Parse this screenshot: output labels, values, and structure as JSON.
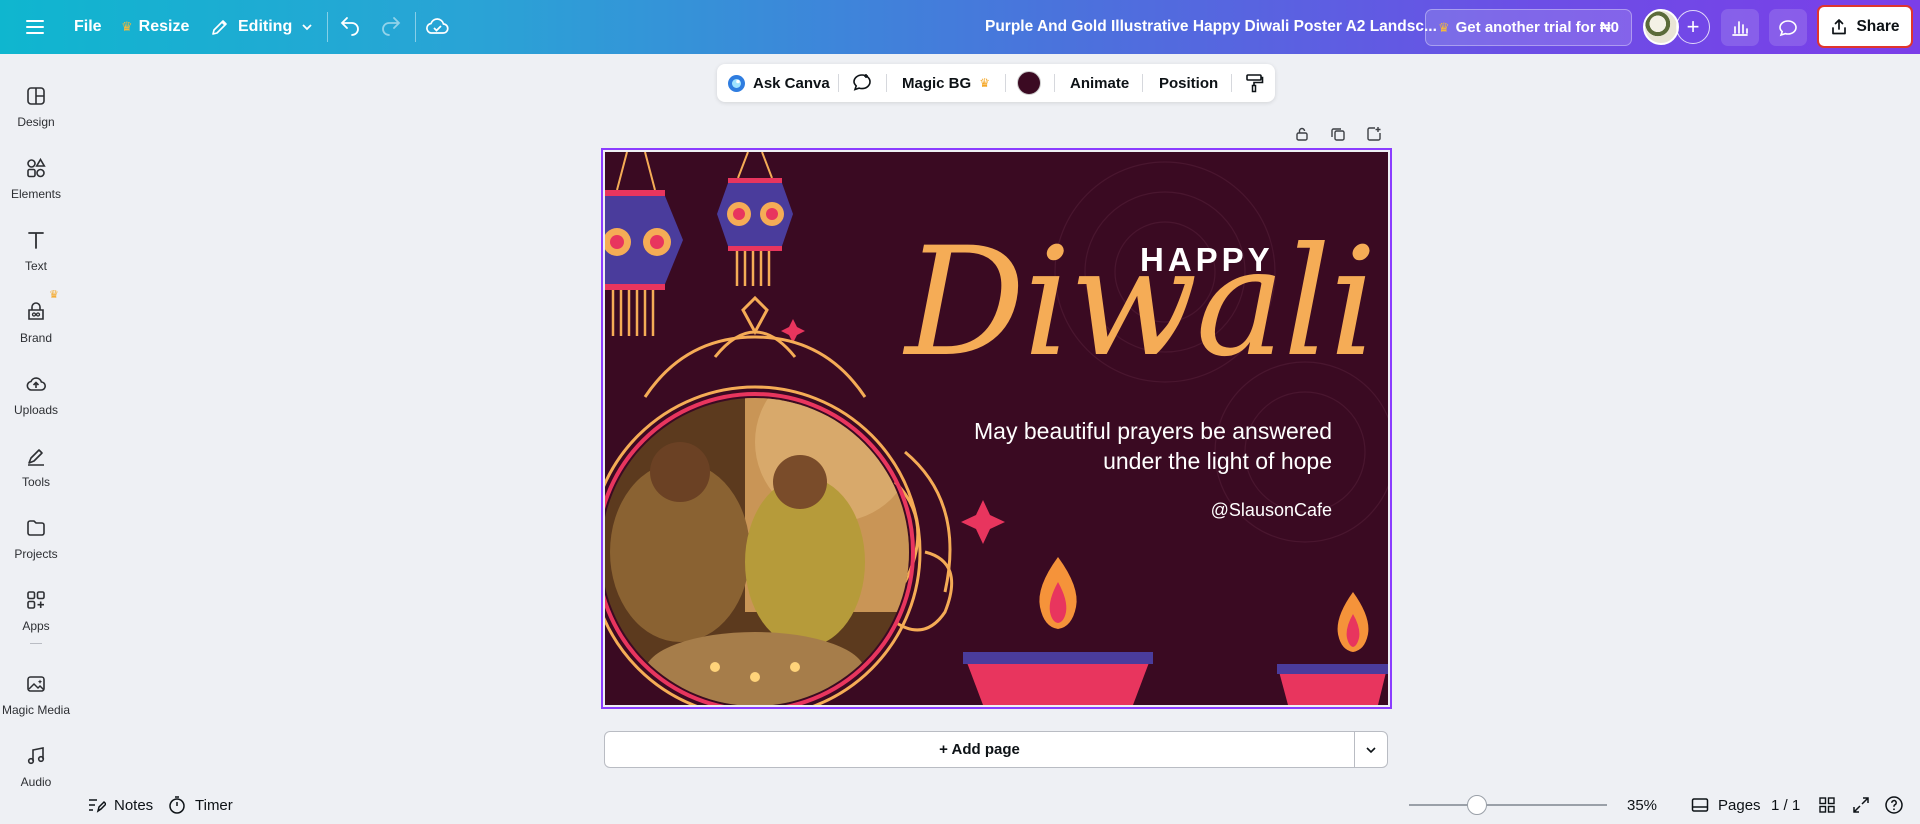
{
  "topbar": {
    "file": "File",
    "resize": "Resize",
    "editing": "Editing",
    "title": "Purple And Gold Illustrative Happy Diwali Poster A2 Landsc...",
    "trial": "Get another trial for ₦0",
    "share": "Share"
  },
  "sidebar": {
    "items": [
      {
        "label": "Design",
        "icon": "design-icon"
      },
      {
        "label": "Elements",
        "icon": "elements-icon"
      },
      {
        "label": "Text",
        "icon": "text-icon"
      },
      {
        "label": "Brand",
        "icon": "brand-icon"
      },
      {
        "label": "Uploads",
        "icon": "uploads-icon"
      },
      {
        "label": "Tools",
        "icon": "tools-icon"
      },
      {
        "label": "Projects",
        "icon": "projects-icon"
      },
      {
        "label": "Apps",
        "icon": "apps-icon"
      },
      {
        "label": "Magic Media",
        "icon": "magic-media-icon"
      },
      {
        "label": "Audio",
        "icon": "audio-icon"
      }
    ]
  },
  "context_toolbar": {
    "ask_canva": "Ask Canva",
    "magic_bg": "Magic BG",
    "animate": "Animate",
    "position": "Position",
    "color": "#3b0a22"
  },
  "design": {
    "happy": "HAPPY",
    "diwali": "Diwali",
    "message_line1": "May beautiful prayers be answered",
    "message_line2": "under the light of hope",
    "handle": "@SlausonCafe",
    "background": "#3a0a22",
    "accent_gold": "#f5ac56",
    "accent_pink": "#e8355e"
  },
  "add_page": "+ Add page",
  "bottombar": {
    "notes": "Notes",
    "timer": "Timer",
    "zoom": "35%",
    "zoom_level": 0.35,
    "pages": "Pages",
    "page_count": "1 / 1"
  },
  "colors": {
    "selection": "#8b3dff",
    "share_border": "#e0342e"
  }
}
